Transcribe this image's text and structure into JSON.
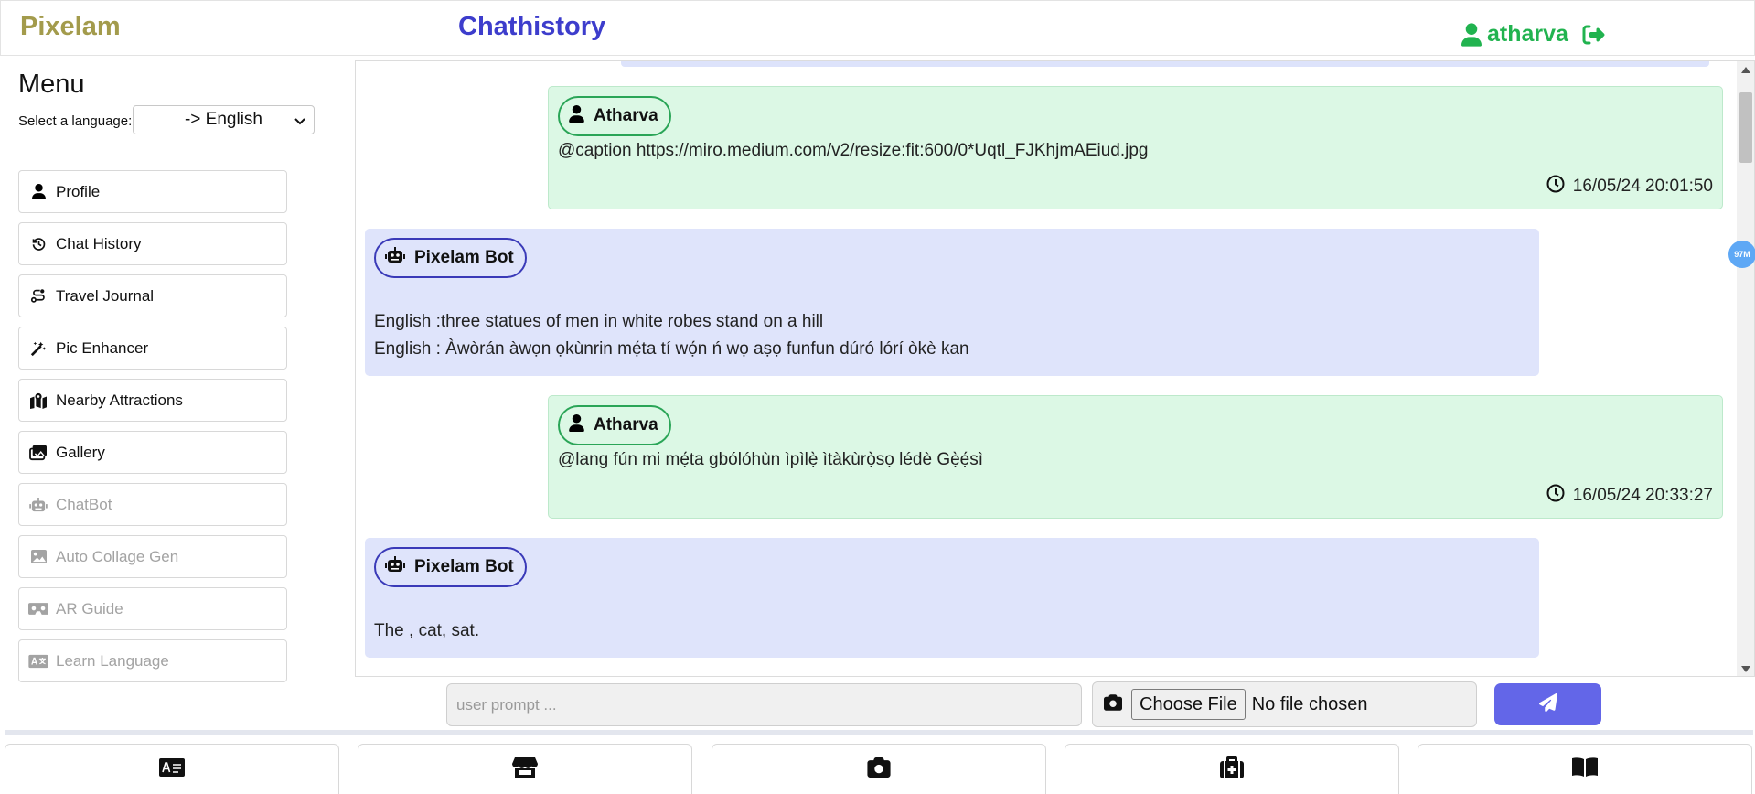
{
  "header": {
    "brand": "Pixelam",
    "title": "Chathistory",
    "username": "atharva",
    "brand_color": "#a39b4c",
    "title_color": "#3d3dcc",
    "user_color": "#21b34f"
  },
  "sidebar": {
    "menu_title": "Menu",
    "language_label": "Select a language:",
    "language_selected": "-> English",
    "items": [
      {
        "label": "Profile",
        "icon": "user-icon",
        "enabled": true
      },
      {
        "label": "Chat History",
        "icon": "history-icon",
        "enabled": true
      },
      {
        "label": "Travel Journal",
        "icon": "route-icon",
        "enabled": true
      },
      {
        "label": "Pic Enhancer",
        "icon": "magic-wand-icon",
        "enabled": true
      },
      {
        "label": "Nearby Attractions",
        "icon": "map-location-icon",
        "enabled": true
      },
      {
        "label": "Gallery",
        "icon": "images-icon",
        "enabled": true
      },
      {
        "label": "ChatBot",
        "icon": "robot-icon",
        "enabled": false
      },
      {
        "label": "Auto Collage Gen",
        "icon": "image-icon",
        "enabled": false
      },
      {
        "label": "AR Guide",
        "icon": "vr-cardboard-icon",
        "enabled": false
      },
      {
        "label": "Learn Language",
        "icon": "language-icon",
        "enabled": false
      }
    ]
  },
  "messages": [
    {
      "sender": "Atharva",
      "role": "user",
      "lines": [
        "@caption https://miro.medium.com/v2/resize:fit:600/0*Uqtl_FJKhjmAEiud.jpg"
      ],
      "time": "16/05/24 20:01:50"
    },
    {
      "sender": "Pixelam Bot",
      "role": "bot",
      "lines": [
        "English :three statues of men in white robes stand on a hill",
        "English : Àwòrán àwọn ọkùnrin mẹ́ta tí wọ́n ń wọ aṣọ funfun dúró lórí òkè kan"
      ]
    },
    {
      "sender": "Atharva",
      "role": "user",
      "lines": [
        "@lang fún mi mẹ́ta gbólóhùn ìpìlẹ̀ ìtàkùrọ̀sọ lédè Gẹ̀ẹ́sì"
      ],
      "time": "16/05/24 20:33:27"
    },
    {
      "sender": "Pixelam Bot",
      "role": "bot",
      "lines": [
        "The , cat, sat."
      ]
    }
  ],
  "composer": {
    "prompt_placeholder": "user prompt ...",
    "file_button": "Choose File",
    "file_status": "No file chosen",
    "send_color": "#6366e8"
  },
  "side_badge": "97M",
  "bottom_nav": [
    {
      "icon": "id-card-icon"
    },
    {
      "icon": "shop-icon"
    },
    {
      "icon": "camera-icon"
    },
    {
      "icon": "medical-kit-icon"
    },
    {
      "icon": "book-icon"
    }
  ]
}
